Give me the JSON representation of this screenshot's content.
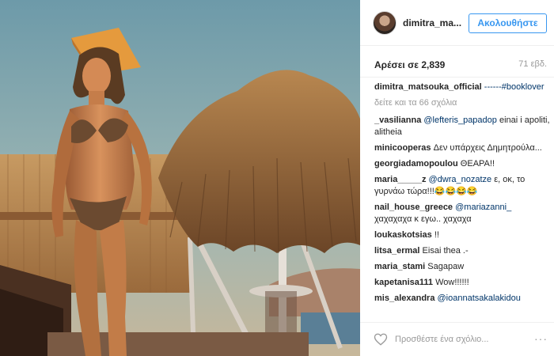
{
  "post": {
    "image_alt": "photo",
    "colors": {
      "accent": "#3897f0",
      "mention": "#003569"
    }
  },
  "header": {
    "username": "dimitra_ma...",
    "follow_label": "Ακολουθήστε"
  },
  "stats": {
    "likes": "Αρέσει σε 2,839",
    "age": "71 εβδ."
  },
  "caption": {
    "user": "dimitra_matsouka_official",
    "text": "------#booklover"
  },
  "view_all": "δείτε και τα 66 σχόλια",
  "comments": [
    {
      "user": "_vasilianna",
      "mention": "@lefteris_papadop",
      "text": " einai i apoliti, alitheia"
    },
    {
      "user": "minicooperas",
      "mention": "",
      "text": "Δεν υπάρχεις Δημητρούλα..."
    },
    {
      "user": "georgiadamopoulou",
      "mention": "",
      "text": "ΘΕΑΡΑ!!"
    },
    {
      "user": "maria_____z",
      "mention": "@dwra_nozatze",
      "text": " ε, οκ, το γυρνάω τώρα!!!😂😂😂😂"
    },
    {
      "user": "nail_house_greece",
      "mention": "@mariazanni_",
      "text": " χαχαχαχα κ εγω.. χαχαχα"
    },
    {
      "user": "loukaskotsias",
      "mention": "",
      "text": "!!"
    },
    {
      "user": "litsa_ermal",
      "mention": "",
      "text": "Eisai thea .-"
    },
    {
      "user": "maria_stami",
      "mention": "",
      "text": "Sagapaw"
    },
    {
      "user": "kapetanisa111",
      "mention": "",
      "text": "Wow!!!!!!"
    },
    {
      "user": "mis_alexandra",
      "mention": "@ioannatsakalakidou",
      "text": ""
    }
  ],
  "footer": {
    "add_comment_placeholder": "Προσθέστε ένα σχόλιο...",
    "more_label": "···",
    "icons": {
      "like": "heart-icon",
      "more": "more-icon"
    }
  }
}
